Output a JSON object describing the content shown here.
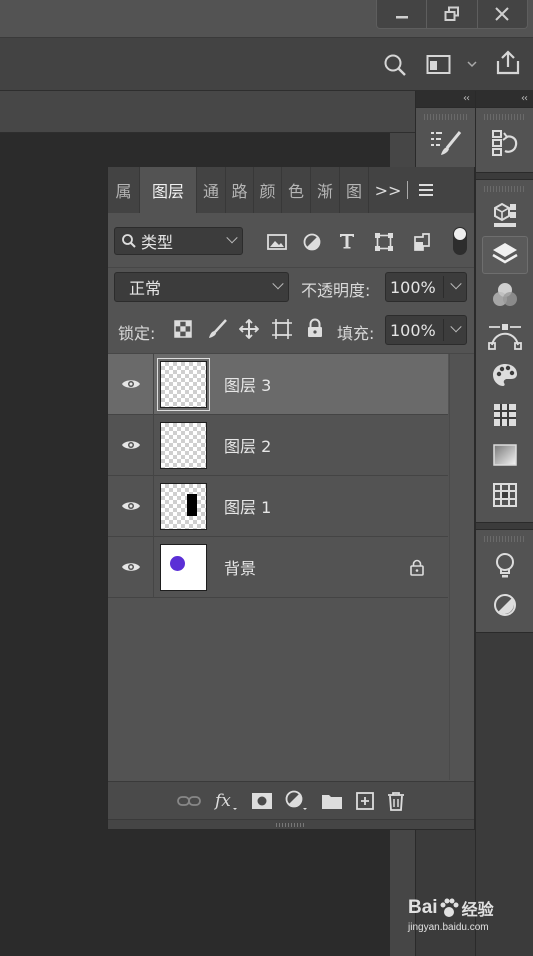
{
  "window": {
    "minimize_icon": "minimize-icon",
    "restore_icon": "restore-icon",
    "close_icon": "close-icon"
  },
  "options_bar": {
    "search_icon": "search-icon",
    "workspace_icon": "workspace-icon",
    "share_icon": "share-icon"
  },
  "panel": {
    "tabs": [
      {
        "label": "属"
      },
      {
        "label": "图层",
        "active": true
      },
      {
        "label": "通"
      },
      {
        "label": "路"
      },
      {
        "label": "颜"
      },
      {
        "label": "色"
      },
      {
        "label": "渐"
      },
      {
        "label": "图"
      }
    ],
    "more_label": ">>",
    "filter": {
      "value": "类型"
    },
    "blend_mode": {
      "value": "正常"
    },
    "opacity": {
      "label": "不透明度:",
      "value": "100%"
    },
    "lock": {
      "label": "锁定:"
    },
    "fill": {
      "label": "填充:",
      "value": "100%"
    },
    "layers": [
      {
        "name": "图层 3",
        "selected": true,
        "visible": true
      },
      {
        "name": "图层 2",
        "selected": false,
        "visible": true
      },
      {
        "name": "图层 1",
        "selected": false,
        "visible": true
      },
      {
        "name": "背景",
        "selected": false,
        "visible": true,
        "locked": true
      }
    ]
  },
  "colors": {
    "accent_dot": "#5b2fd6",
    "selected_row": "#6a6a6a"
  },
  "watermark": {
    "brand": "Bai",
    "brand2": "经验",
    "url": "jingyan.baidu.com"
  }
}
